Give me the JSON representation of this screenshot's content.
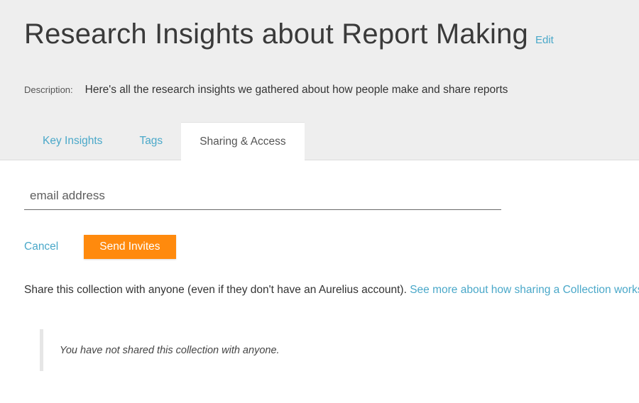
{
  "header": {
    "title": "Research Insights about Report Making",
    "edit_label": "Edit",
    "description_label": "Description:",
    "description_text": "Here's all the research insights we gathered about how people make and share reports"
  },
  "tabs": [
    {
      "label": "Key Insights",
      "active": false
    },
    {
      "label": "Tags",
      "active": false
    },
    {
      "label": "Sharing & Access",
      "active": true
    }
  ],
  "invite_form": {
    "email_placeholder": "email address",
    "email_value": "",
    "cancel_label": "Cancel",
    "send_label": "Send Invites"
  },
  "share_info": {
    "text": "Share this collection with anyone (even if they don't have an Aurelius account).",
    "link_text": "See more about how sharing a Collection works."
  },
  "notice": {
    "text": "You have not shared this collection with anyone."
  },
  "colors": {
    "header_bg": "#eeeeee",
    "link": "#4aa8c9",
    "accent_button": "#ff8a0d"
  }
}
